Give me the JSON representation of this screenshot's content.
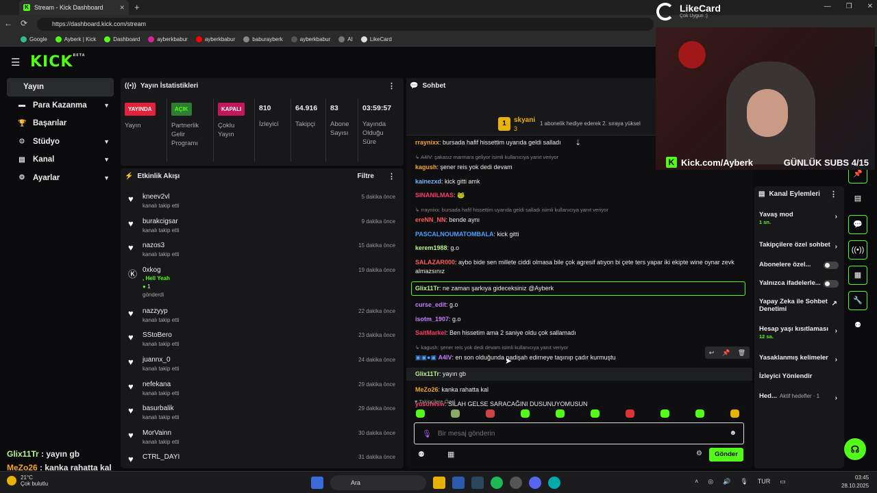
{
  "browser": {
    "tab_title": "Stream - Kick Dashboard",
    "url": "https://dashboard.kick.com/stream",
    "bookmarks": [
      "Google",
      "Ayberk | Kick",
      "Dashboard",
      "ayberkbabur",
      "ayberkbabur",
      "baburayberk",
      "ayberkbabur",
      "AI",
      "LikeCard"
    ]
  },
  "logo": "KICK",
  "logo_badge": "BETA",
  "sidebar": {
    "items": [
      {
        "label": "Yayın",
        "icon": "broadcast-icon",
        "active": true
      },
      {
        "label": "Para Kazanma",
        "icon": "money-icon"
      },
      {
        "label": "Başarılar",
        "icon": "trophy-icon"
      },
      {
        "label": "Stüdyo",
        "icon": "studio-icon"
      },
      {
        "label": "Kanal",
        "icon": "channel-icon"
      },
      {
        "label": "Ayarlar",
        "icon": "gear-icon"
      }
    ]
  },
  "overlay_chat": [
    {
      "user": "Glix11Tr",
      "text": " : yayın gb",
      "color": "#b9f58a"
    },
    {
      "user": "MeZo26",
      "text": " : kanka rahatta kal",
      "color": "#f4a52a"
    }
  ],
  "stats": {
    "title": "Yayın İstatistikleri",
    "cols": [
      {
        "badge": "YAYINDA",
        "badge_color": "#e0223a",
        "label": "Yayın"
      },
      {
        "badge": "AÇIK",
        "badge_color": "#2e7d32",
        "label": "Partnerlik Gelir Programı"
      },
      {
        "badge": "KAPALI",
        "badge_color": "#c2185b",
        "label": "Çoklu Yayın"
      },
      {
        "num": "810",
        "label": "İzleyici"
      },
      {
        "num": "64.916",
        "label": "Takipçi"
      },
      {
        "num": "83",
        "label": "Abone Sayısı"
      },
      {
        "num": "03:59:57",
        "label": "Yayında Olduğu Süre"
      }
    ]
  },
  "activity": {
    "title": "Etkinlik Akışı",
    "filter": "Filtre",
    "rows": [
      {
        "name": "kneev2vl",
        "sub": "kanalı takip etti",
        "time": "5 dakika önce"
      },
      {
        "name": "burakcigsar",
        "sub": "kanalı takip etti",
        "time": "9 dakika önce"
      },
      {
        "name": "nazos3",
        "sub": "kanalı takip etti",
        "time": "15 dakika önce"
      },
      {
        "name": "0xkog",
        "extra": ", Hell Yeah",
        "count": "1",
        "sub": "gönderdi",
        "time": "19 dakika önce"
      },
      {
        "name": "nazzyyp",
        "sub": "kanalı takip etti",
        "time": "22 dakika önce"
      },
      {
        "name": "SStoBero",
        "sub": "kanalı takip etti",
        "time": "23 dakika önce"
      },
      {
        "name": "juannx_0",
        "sub": "kanalı takip etti",
        "time": "24 dakika önce"
      },
      {
        "name": "nefekana",
        "sub": "kanalı takip etti",
        "time": "29 dakika önce"
      },
      {
        "name": "basurbalik",
        "sub": "kanalı takip etti",
        "time": "29 dakika önce"
      },
      {
        "name": "MorVainn",
        "sub": "kanalı takip etti",
        "time": "30 dakika önce"
      },
      {
        "name": "CTRL_DAYI",
        "sub": "",
        "time": "31 dakika önce"
      }
    ]
  },
  "chat": {
    "title": "Sohbet",
    "pinned": {
      "user": "skyani",
      "count": "3",
      "rank": "1",
      "text": "1 abonelik hediye ederek 2. sıraya yüksel"
    },
    "messages": [
      {
        "user": "rraynixx",
        "color": "#f4a52a",
        "text": ": bursada hafif hissettim uyarıda geldi salladı"
      },
      {
        "reply": "↳ A4IV: şakasız marmara geliyor isimli kullanıcıya yanıt veriyor",
        "user": "kagush",
        "color": "#f4a52a",
        "text": ": şener reis yok dedi devam"
      },
      {
        "user": "kainezxd",
        "color": "#7ab3ff",
        "text": ": kick gitti amk"
      },
      {
        "user": "SINANILMAS",
        "color": "#ff3b6b",
        "text": ": 🐸"
      },
      {
        "reply": "↳ rraynixx: bursada hafif hissettim uyarıda geldi salladı isimli kullanıcıya yanıt veriyor",
        "user": "ereNN_NN",
        "color": "#ff5a5a",
        "text": ": bende aynı"
      },
      {
        "user": "PASCALNOUMATOMBALA",
        "color": "#4aa3ff",
        "text": ": kick gitti"
      },
      {
        "user": "kerem1988",
        "color": "#b9f58a",
        "text": ": g.o"
      },
      {
        "user": "SALAZAR000",
        "color": "#ff5a5a",
        "text": ": aybo bide sen millete ciddi olmasa bile çok agresif atıyon bi çete ters yapar iki ekipte wine oynar zevk almazsınız"
      },
      {
        "user": "Glix11Tr",
        "color": "#b9f58a",
        "text": ": ne zaman şarkıya gideceksiniz @Ayberk",
        "highlight": true
      },
      {
        "user": "curse_edit",
        "color": "#c77dff",
        "text": ": g.o"
      },
      {
        "user": "isotm_1907",
        "color": "#c77dff",
        "text": ": g.o"
      },
      {
        "user": "SaitMarkel",
        "color": "#ff3b6b",
        "text": ": Ben hissetim ama 2 saniye oldu çok sallamadı"
      },
      {
        "reply": "↳ kagush: şener reis yok dedi devam isimli kullanıcıya yanıt veriyor",
        "user": "A4IV",
        "color": "#c77dff",
        "text": ": en son olduğunda padişah edirneye taşınıp çadır kurmuştu",
        "badges": true
      },
      {
        "user": "Glix11Tr",
        "color": "#b9f58a",
        "text": ": yayın gb",
        "hover": true
      },
      {
        "user": "MeZo26",
        "color": "#f4a52a",
        "text": ": kanka rahatta kal"
      },
      {
        "user": "yusufwsw",
        "color": "#ff3b6b",
        "text": ": SİLAH GELSE SARACAĞINI DUSUNUYOMUSUN"
      }
    ],
    "emote_title": "♥ Takipçilere Özel",
    "input_placeholder": "Bir mesaj gönderin",
    "send_label": "Gönder"
  },
  "channel_actions": {
    "title": "Kanal Eylemleri",
    "items": [
      {
        "label": "Yavaş mod",
        "sub": "1 sn.",
        "kind": "arrow"
      },
      {
        "label": "Takipçilere özel sohbet",
        "kind": "arrow"
      },
      {
        "label": "Abonelere özel...",
        "kind": "toggle"
      },
      {
        "label": "Yalnızca ifadelerle...",
        "kind": "toggle"
      },
      {
        "label": "Yapay Zeka ile Sohbet Denetimi",
        "kind": "ext"
      },
      {
        "label": "Hesap yaşı kısıtlaması",
        "sub": "12 sa.",
        "kind": "arrow"
      },
      {
        "label": "Yasaklanmış kelimeler",
        "kind": "arrow"
      },
      {
        "label": "İzleyici Yönlendir",
        "kind": "none"
      },
      {
        "label": "Hed...",
        "sub2": "Aktif hedefler · 1",
        "kind": "arrow"
      }
    ]
  },
  "webcam": {
    "brand": "LikeCard",
    "brand_sub": "Çok Uygun :)",
    "channel": "Kick.com/Ayberk",
    "subs_goal": "GÜNLÜK SUBS 4/15"
  },
  "taskbar": {
    "temp": "21°C",
    "weather": "Çok bulutlu",
    "search": "Ara",
    "lang": "TUR",
    "time": "03:45",
    "date": "28.10.2025"
  }
}
